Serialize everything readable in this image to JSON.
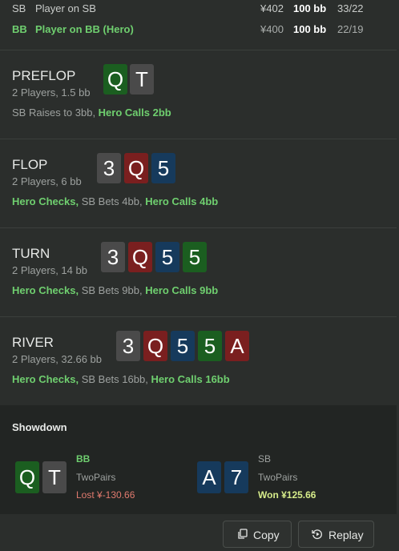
{
  "players": [
    {
      "pos": "SB",
      "name": "Player on SB",
      "money": "¥402",
      "bb": "100 bb",
      "stat": "33/22",
      "hero": false
    },
    {
      "pos": "BB",
      "name": "Player on BB (Hero)",
      "money": "¥400",
      "bb": "100 bb",
      "stat": "22/19",
      "hero": true
    }
  ],
  "streets": [
    {
      "name": "PREFLOP",
      "info": "2 Players, 1.5 bb",
      "actions": [
        {
          "text": "SB Raises to 3bb, ",
          "hero": false
        },
        {
          "text": "Hero Calls 2bb",
          "hero": true
        }
      ],
      "cards": [
        {
          "rank": "Q",
          "color": "green"
        },
        {
          "rank": "T",
          "color": "gray"
        }
      ]
    },
    {
      "name": "FLOP",
      "info": "2 Players, 6 bb",
      "actions": [
        {
          "text": "Hero Checks, ",
          "hero": true
        },
        {
          "text": "SB Bets 4bb, ",
          "hero": false
        },
        {
          "text": "Hero Calls 4bb",
          "hero": true
        }
      ],
      "cards": [
        {
          "rank": "3",
          "color": "gray"
        },
        {
          "rank": "Q",
          "color": "red"
        },
        {
          "rank": "5",
          "color": "blue"
        }
      ]
    },
    {
      "name": "TURN",
      "info": "2 Players, 14 bb",
      "actions": [
        {
          "text": "Hero Checks, ",
          "hero": true
        },
        {
          "text": "SB Bets 9bb, ",
          "hero": false
        },
        {
          "text": "Hero Calls 9bb",
          "hero": true
        }
      ],
      "cards": [
        {
          "rank": "3",
          "color": "gray"
        },
        {
          "rank": "Q",
          "color": "red"
        },
        {
          "rank": "5",
          "color": "blue"
        },
        {
          "rank": "5",
          "color": "green"
        }
      ]
    },
    {
      "name": "RIVER",
      "info": "2 Players, 32.66 bb",
      "actions": [
        {
          "text": "Hero Checks, ",
          "hero": true
        },
        {
          "text": "SB Bets 16bb, ",
          "hero": false
        },
        {
          "text": "Hero Calls 16bb",
          "hero": true
        }
      ],
      "cards": [
        {
          "rank": "3",
          "color": "gray"
        },
        {
          "rank": "Q",
          "color": "red"
        },
        {
          "rank": "5",
          "color": "blue"
        },
        {
          "rank": "5",
          "color": "green"
        },
        {
          "rank": "A",
          "color": "red"
        }
      ]
    }
  ],
  "showdown": {
    "title": "Showdown",
    "hands": [
      {
        "pos": "BB",
        "hand": "TwoPairs",
        "result": "Lost ¥-130.66",
        "outcome": "lost",
        "cards": [
          {
            "rank": "Q",
            "color": "green"
          },
          {
            "rank": "T",
            "color": "gray"
          }
        ]
      },
      {
        "pos": "SB",
        "hand": "TwoPairs",
        "result": "Won ¥125.66",
        "outcome": "won",
        "cards": [
          {
            "rank": "A",
            "color": "blue"
          },
          {
            "rank": "7",
            "color": "blue"
          }
        ]
      }
    ]
  },
  "buttons": {
    "copy": "Copy",
    "replay": "Replay",
    "copy_icon": "copy-icon",
    "replay_icon": "replay-icon"
  },
  "colors": {
    "hero": "#6fcf6f",
    "lost": "#e07a6e",
    "won": "#d6ec8a",
    "card_green": "#1b5e20",
    "card_red": "#7a1f1f",
    "card_blue": "#163a5c",
    "card_gray": "#4a4a4a"
  }
}
